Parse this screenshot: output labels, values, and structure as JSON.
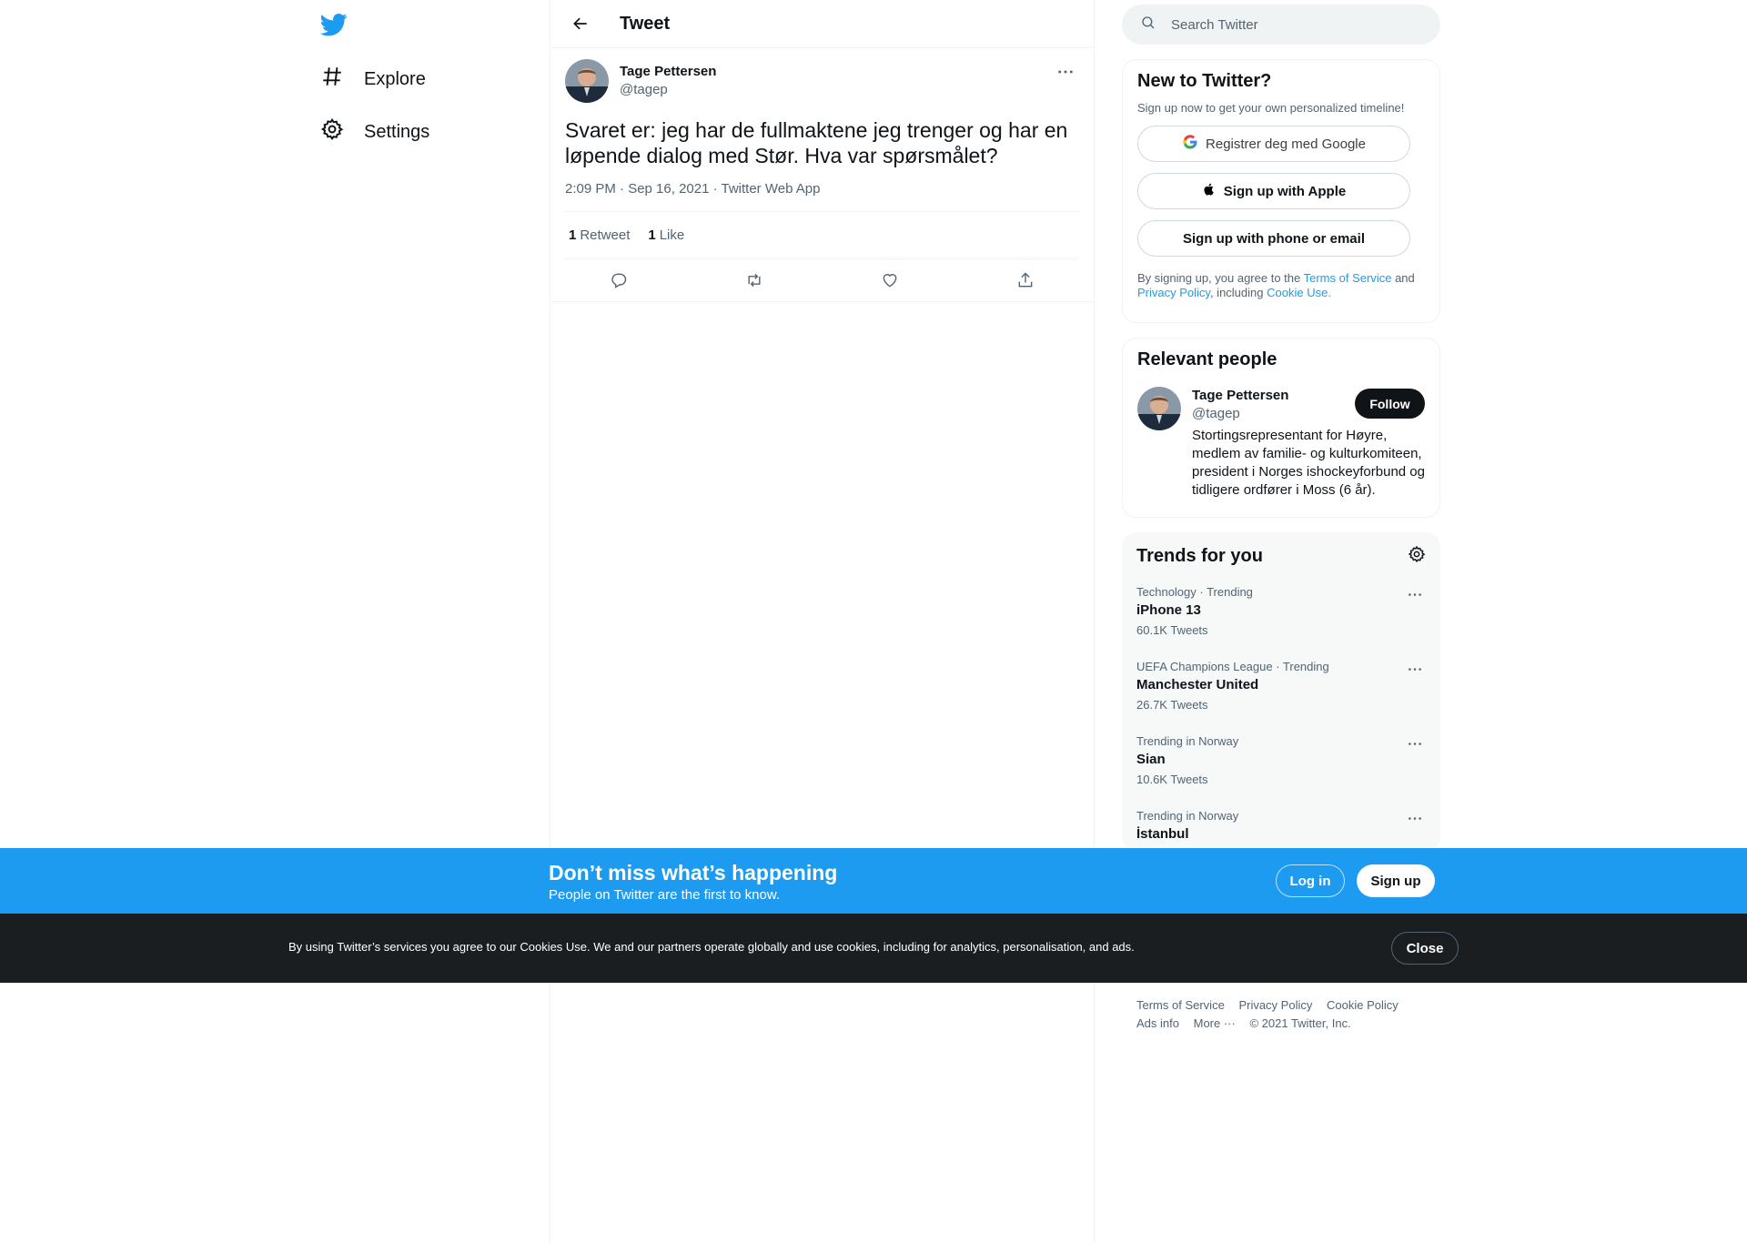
{
  "colors": {
    "brand": "#1d9bf0",
    "text": "#0f1419",
    "secondary": "#536471",
    "cookie_bg": "#1b1e21"
  },
  "nav": {
    "logo_icon": "twitter-bird-icon",
    "items": [
      {
        "label": "Explore",
        "icon": "hashtag-icon"
      },
      {
        "label": "Settings",
        "icon": "gear-icon"
      }
    ]
  },
  "main": {
    "title": "Tweet",
    "tweet": {
      "author_name": "Tage Pettersen",
      "author_handle": "@tagep",
      "text": "Svaret er: jeg har de fullmaktene jeg trenger og har en løpende dialog med Stør. Hva var spørsmålet?",
      "meta": "2:09 PM · Sep 16, 2021 · Twitter Web App",
      "retweet_count": "1",
      "retweet_label": "Retweet",
      "like_count": "1",
      "like_label": "Like"
    }
  },
  "search": {
    "placeholder": "Search Twitter"
  },
  "signup": {
    "title": "New to Twitter?",
    "subtitle": "Sign up now to get your own personalized timeline!",
    "google_label": "Registrer deg med Google",
    "apple_label": "Sign up with Apple",
    "phone_label": "Sign up with phone or email",
    "legal_prefix": "By signing up, you agree to the",
    "terms": "Terms of Service",
    "and": "and",
    "privacy": "Privacy Policy",
    "including": ", including",
    "cookie": "Cookie Use."
  },
  "people": {
    "title": "Relevant people",
    "name": "Tage Pettersen",
    "handle": "@tagep",
    "follow": "Follow",
    "bio": "Stortingsrepresentant for Høyre, medlem av familie- og kulturkomiteen, president i Norges ishockeyforbund og tidligere ordfører i Moss (6 år)."
  },
  "trends": {
    "title": "Trends for you",
    "items": [
      {
        "meta": "Technology · Trending",
        "name": "iPhone 13",
        "count": "60.1K Tweets"
      },
      {
        "meta": "UEFA Champions League · Trending",
        "name": "Manchester United",
        "count": "26.7K Tweets"
      },
      {
        "meta": "Trending in Norway",
        "name": "Sian",
        "count": "10.6K Tweets"
      },
      {
        "meta": "Trending in Norway",
        "name": "İstanbul",
        "count": ""
      }
    ]
  },
  "footer": {
    "terms": "Terms of Service",
    "privacy": "Privacy Policy",
    "cookie": "Cookie Policy",
    "ads": "Ads info",
    "more": "More ···",
    "copyright": "© 2021 Twitter, Inc."
  },
  "bluebar": {
    "title": "Don’t miss what’s happening",
    "subtitle": "People on Twitter are the first to know.",
    "login": "Log in",
    "signup": "Sign up"
  },
  "cookiebar": {
    "text": "By using Twitter’s services you agree to our Cookies Use. We and our partners operate globally and use cookies, including for analytics, personalisation, and ads.",
    "close": "Close"
  }
}
